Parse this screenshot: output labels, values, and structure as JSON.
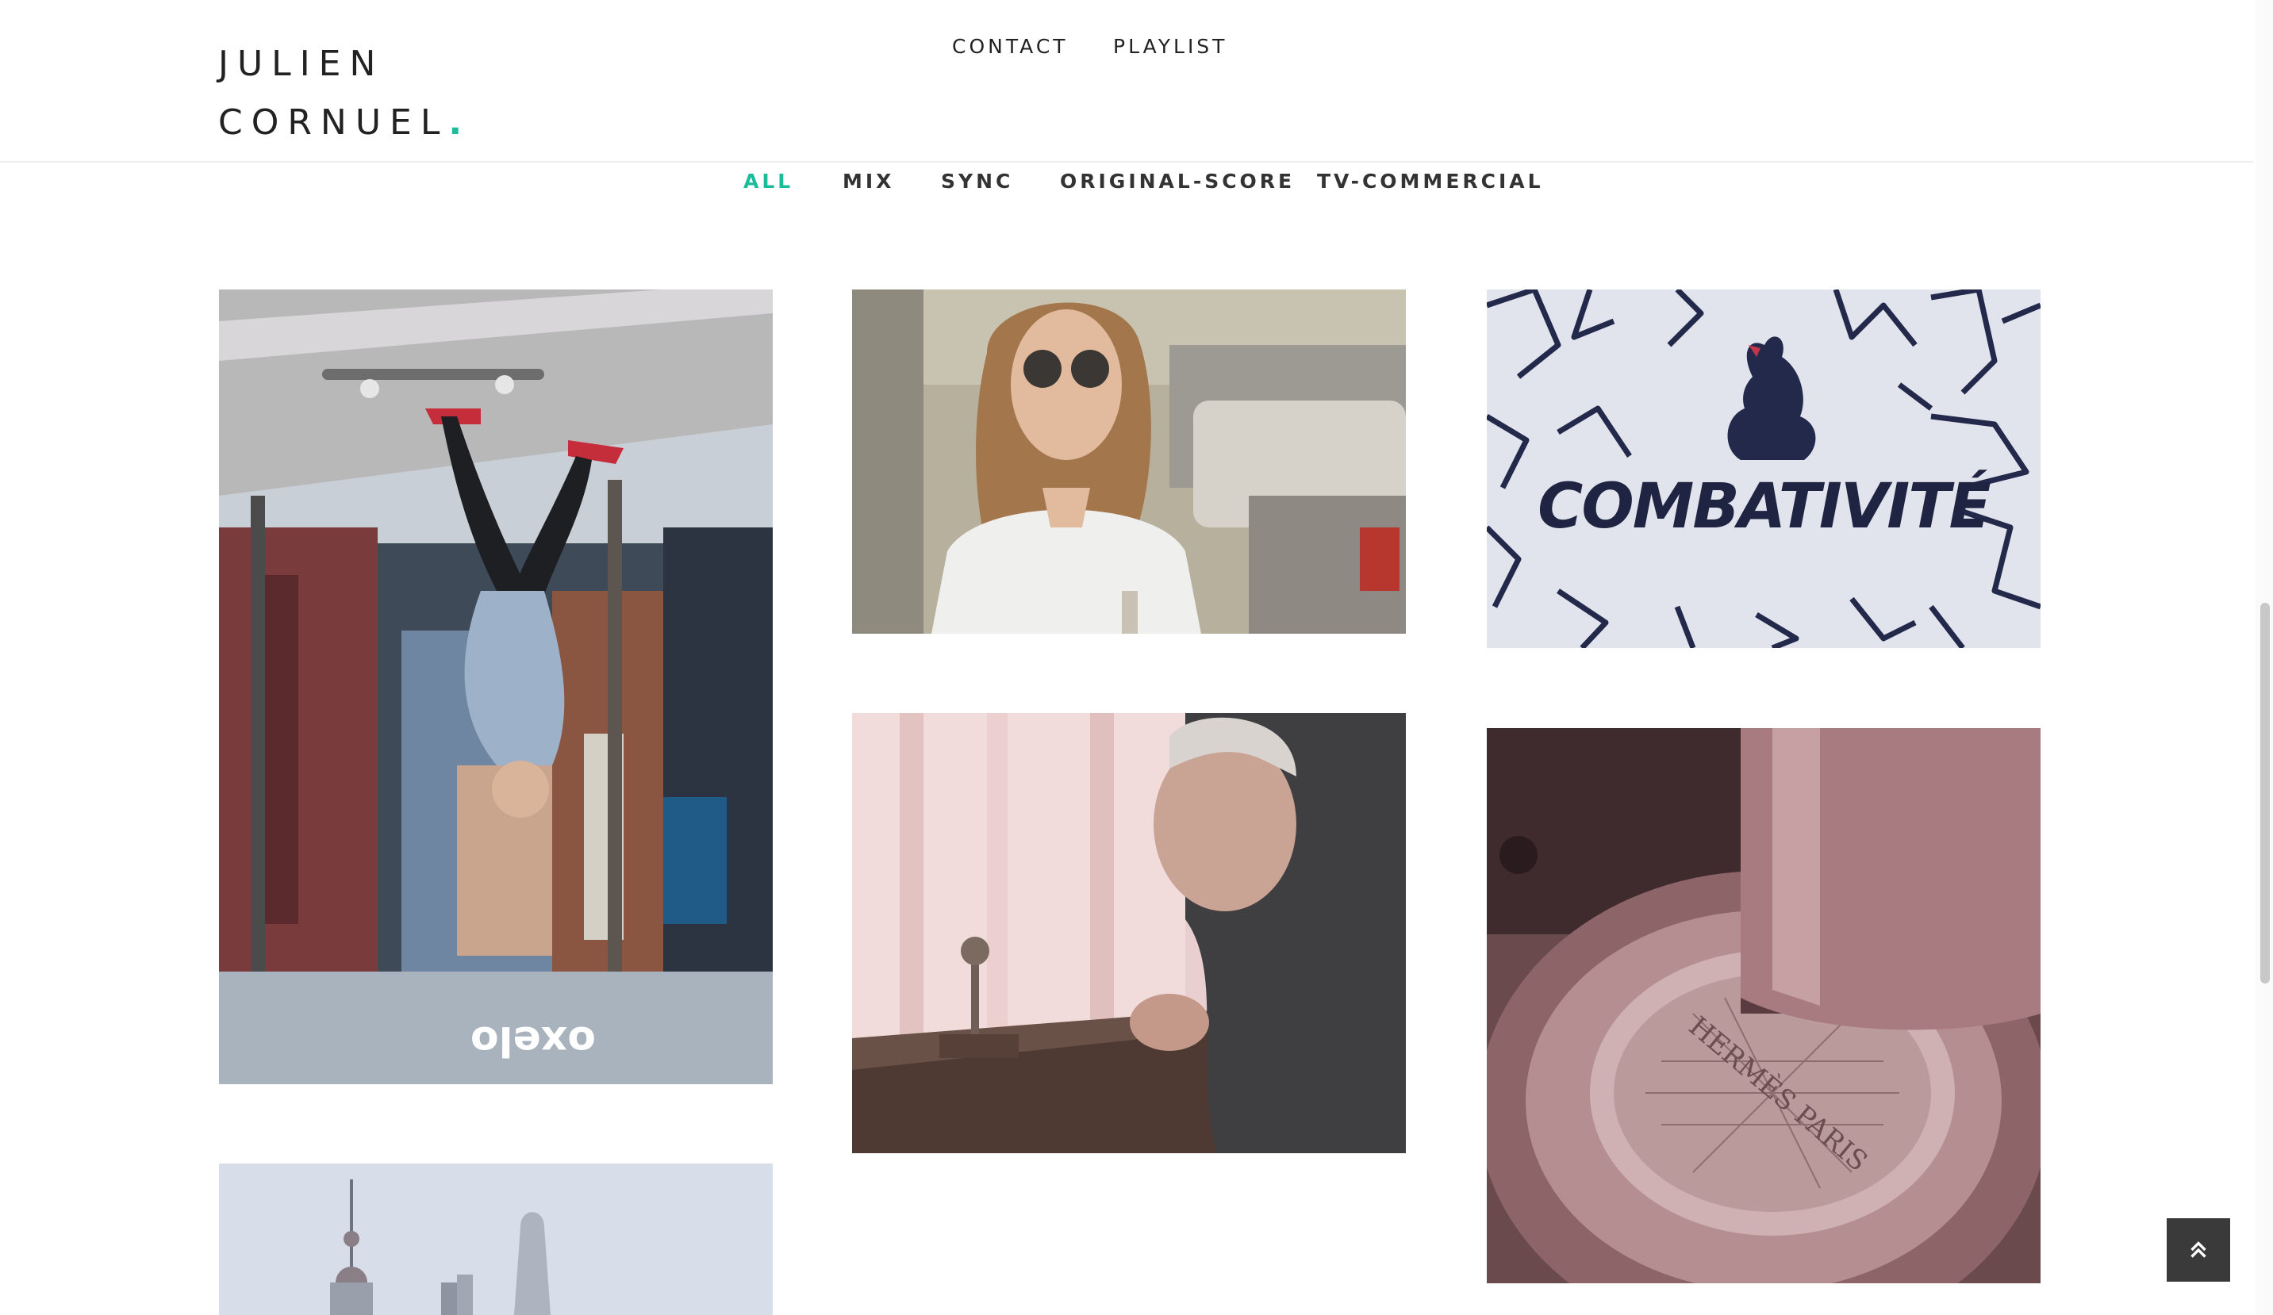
{
  "brand": {
    "line1": "JULIEN",
    "line2": "CORNUEL",
    "dot": ".",
    "accent_color": "#1abc9c"
  },
  "nav": {
    "contact": "CONTACT",
    "playlist": "PLAYLIST"
  },
  "filters": [
    "ALL",
    "MIX",
    "SYNC",
    "ORIGINAL-SCORE",
    "TV-COMMERCIAL"
  ],
  "active_filter": "ALL",
  "tiles": {
    "skateboard": {
      "watermark": "oxelo"
    },
    "woman_sunglasses": {},
    "combativite": {
      "text": "COMBATIVITÉ"
    },
    "watchmaker": {},
    "watch_movement": {
      "text": "HERMÈS PARIS"
    },
    "city_skyline": {}
  },
  "icons": {
    "back_to_top": "double-chevron-up-icon"
  }
}
